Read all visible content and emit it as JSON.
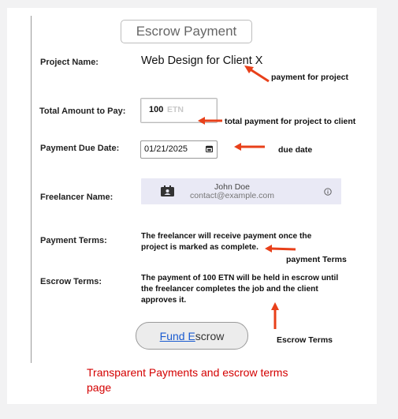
{
  "header": {
    "title": "Escrow Payment"
  },
  "form": {
    "project_label": "Project Name:",
    "project_value": "Web Design for Client X",
    "amount_label": "Total Amount to Pay:",
    "amount_value": "100",
    "amount_unit": "ETN",
    "due_label": "Payment Due Date:",
    "due_value": "01/21/2025",
    "freelancer_label": "Freelancer Name:",
    "freelancer_name": "John Doe",
    "freelancer_email": "contact@example.com",
    "payment_terms_label": "Payment Terms:",
    "payment_terms_line1": "The freelancer will receive payment once the",
    "payment_terms_line2": "project is marked as complete.",
    "escrow_terms_label": "Escrow Terms:",
    "escrow_terms_line1": "The payment of 100 ETN will be held in escrow until",
    "escrow_terms_line2": "the freelancer completes the job and the client",
    "escrow_terms_line3": "approves it.",
    "fund_button_underlined": "Fund E",
    "fund_button_rest": "scrow"
  },
  "annotations": {
    "project": "payment for project",
    "amount": "total payment for project to client",
    "due": "due date",
    "payment_terms": "payment Terms",
    "escrow_terms": "Escrow Terms",
    "arrow_color": "#e8401a"
  },
  "caption": {
    "line1": "Transparent Payments and escrow  terms",
    "line2": "page"
  },
  "icons": {
    "calendar": "calendar-icon",
    "contact": "contact-card-icon",
    "info": "info-icon"
  }
}
